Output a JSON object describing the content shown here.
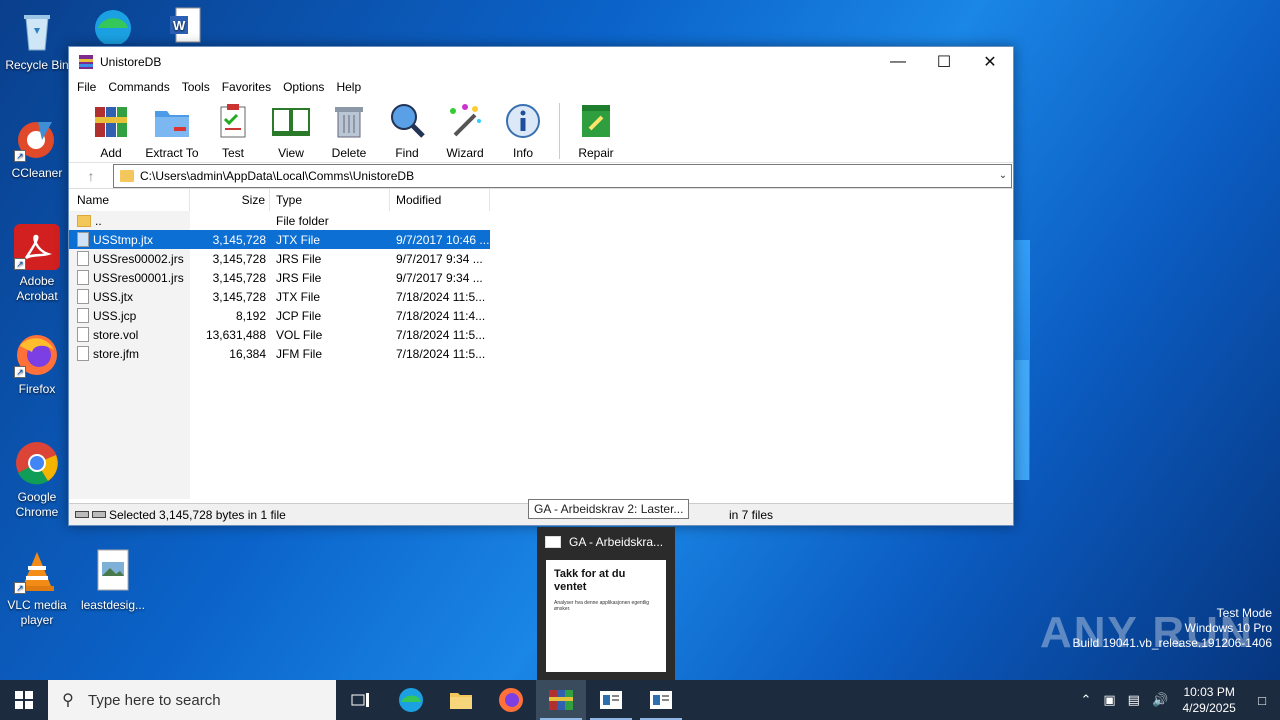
{
  "desktop": {
    "icons": [
      {
        "label": "Recycle Bin"
      },
      {
        "label": "CCleaner"
      },
      {
        "label": "Adobe Acrobat"
      },
      {
        "label": "Firefox"
      },
      {
        "label": "Google Chrome"
      },
      {
        "label": "VLC media player"
      },
      {
        "label": "leastdesig..."
      }
    ]
  },
  "window": {
    "title": "UnistoreDB",
    "menu": [
      "File",
      "Commands",
      "Tools",
      "Favorites",
      "Options",
      "Help"
    ],
    "toolbar": [
      "Add",
      "Extract To",
      "Test",
      "View",
      "Delete",
      "Find",
      "Wizard",
      "Info",
      "Repair"
    ],
    "address": "C:\\Users\\admin\\AppData\\Local\\Comms\\UnistoreDB",
    "columns": {
      "name": "Name",
      "size": "Size",
      "type": "Type",
      "modified": "Modified"
    },
    "files": [
      {
        "name": "..",
        "size": "",
        "type": "File folder",
        "modified": ""
      },
      {
        "name": "USStmp.jtx",
        "size": "3,145,728",
        "type": "JTX File",
        "modified": "9/7/2017 10:46 ..."
      },
      {
        "name": "USSres00002.jrs",
        "size": "3,145,728",
        "type": "JRS File",
        "modified": "9/7/2017 9:34 ..."
      },
      {
        "name": "USSres00001.jrs",
        "size": "3,145,728",
        "type": "JRS File",
        "modified": "9/7/2017 9:34 ..."
      },
      {
        "name": "USS.jtx",
        "size": "3,145,728",
        "type": "JTX File",
        "modified": "7/18/2024 11:5..."
      },
      {
        "name": "USS.jcp",
        "size": "8,192",
        "type": "JCP File",
        "modified": "7/18/2024 11:4..."
      },
      {
        "name": "store.vol",
        "size": "13,631,488",
        "type": "VOL File",
        "modified": "7/18/2024 11:5..."
      },
      {
        "name": "store.jfm",
        "size": "16,384",
        "type": "JFM File",
        "modified": "7/18/2024 11:5..."
      }
    ],
    "status_left": "Selected 3,145,728 bytes in 1 file",
    "status_right": "in 7 files"
  },
  "tooltip": "GA - Arbeidskrav 2: Laster...",
  "preview": {
    "title": "GA - Arbeidskra...",
    "heading": "Takk for at du ventet",
    "body": "Analyser hva denne applikasjonen egentlig ønsker."
  },
  "watermark": {
    "line1": "Test Mode",
    "line2": "Windows 10 Pro",
    "line3": "Build 19041.vb_release.191206-1406",
    "brand": "ANY RUN"
  },
  "taskbar": {
    "search_placeholder": "Type here to search",
    "time": "10:03 PM",
    "date": "4/29/2025"
  }
}
